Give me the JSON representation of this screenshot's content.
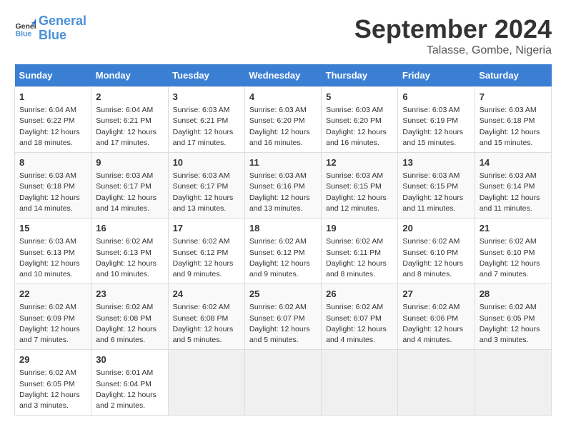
{
  "header": {
    "logo_line1": "General",
    "logo_line2": "Blue",
    "month": "September 2024",
    "location": "Talasse, Gombe, Nigeria"
  },
  "columns": [
    "Sunday",
    "Monday",
    "Tuesday",
    "Wednesday",
    "Thursday",
    "Friday",
    "Saturday"
  ],
  "weeks": [
    [
      {
        "day": "1",
        "info": "Sunrise: 6:04 AM\nSunset: 6:22 PM\nDaylight: 12 hours\nand 18 minutes."
      },
      {
        "day": "2",
        "info": "Sunrise: 6:04 AM\nSunset: 6:21 PM\nDaylight: 12 hours\nand 17 minutes."
      },
      {
        "day": "3",
        "info": "Sunrise: 6:03 AM\nSunset: 6:21 PM\nDaylight: 12 hours\nand 17 minutes."
      },
      {
        "day": "4",
        "info": "Sunrise: 6:03 AM\nSunset: 6:20 PM\nDaylight: 12 hours\nand 16 minutes."
      },
      {
        "day": "5",
        "info": "Sunrise: 6:03 AM\nSunset: 6:20 PM\nDaylight: 12 hours\nand 16 minutes."
      },
      {
        "day": "6",
        "info": "Sunrise: 6:03 AM\nSunset: 6:19 PM\nDaylight: 12 hours\nand 15 minutes."
      },
      {
        "day": "7",
        "info": "Sunrise: 6:03 AM\nSunset: 6:18 PM\nDaylight: 12 hours\nand 15 minutes."
      }
    ],
    [
      {
        "day": "8",
        "info": "Sunrise: 6:03 AM\nSunset: 6:18 PM\nDaylight: 12 hours\nand 14 minutes."
      },
      {
        "day": "9",
        "info": "Sunrise: 6:03 AM\nSunset: 6:17 PM\nDaylight: 12 hours\nand 14 minutes."
      },
      {
        "day": "10",
        "info": "Sunrise: 6:03 AM\nSunset: 6:17 PM\nDaylight: 12 hours\nand 13 minutes."
      },
      {
        "day": "11",
        "info": "Sunrise: 6:03 AM\nSunset: 6:16 PM\nDaylight: 12 hours\nand 13 minutes."
      },
      {
        "day": "12",
        "info": "Sunrise: 6:03 AM\nSunset: 6:15 PM\nDaylight: 12 hours\nand 12 minutes."
      },
      {
        "day": "13",
        "info": "Sunrise: 6:03 AM\nSunset: 6:15 PM\nDaylight: 12 hours\nand 11 minutes."
      },
      {
        "day": "14",
        "info": "Sunrise: 6:03 AM\nSunset: 6:14 PM\nDaylight: 12 hours\nand 11 minutes."
      }
    ],
    [
      {
        "day": "15",
        "info": "Sunrise: 6:03 AM\nSunset: 6:13 PM\nDaylight: 12 hours\nand 10 minutes."
      },
      {
        "day": "16",
        "info": "Sunrise: 6:02 AM\nSunset: 6:13 PM\nDaylight: 12 hours\nand 10 minutes."
      },
      {
        "day": "17",
        "info": "Sunrise: 6:02 AM\nSunset: 6:12 PM\nDaylight: 12 hours\nand 9 minutes."
      },
      {
        "day": "18",
        "info": "Sunrise: 6:02 AM\nSunset: 6:12 PM\nDaylight: 12 hours\nand 9 minutes."
      },
      {
        "day": "19",
        "info": "Sunrise: 6:02 AM\nSunset: 6:11 PM\nDaylight: 12 hours\nand 8 minutes."
      },
      {
        "day": "20",
        "info": "Sunrise: 6:02 AM\nSunset: 6:10 PM\nDaylight: 12 hours\nand 8 minutes."
      },
      {
        "day": "21",
        "info": "Sunrise: 6:02 AM\nSunset: 6:10 PM\nDaylight: 12 hours\nand 7 minutes."
      }
    ],
    [
      {
        "day": "22",
        "info": "Sunrise: 6:02 AM\nSunset: 6:09 PM\nDaylight: 12 hours\nand 7 minutes."
      },
      {
        "day": "23",
        "info": "Sunrise: 6:02 AM\nSunset: 6:08 PM\nDaylight: 12 hours\nand 6 minutes."
      },
      {
        "day": "24",
        "info": "Sunrise: 6:02 AM\nSunset: 6:08 PM\nDaylight: 12 hours\nand 5 minutes."
      },
      {
        "day": "25",
        "info": "Sunrise: 6:02 AM\nSunset: 6:07 PM\nDaylight: 12 hours\nand 5 minutes."
      },
      {
        "day": "26",
        "info": "Sunrise: 6:02 AM\nSunset: 6:07 PM\nDaylight: 12 hours\nand 4 minutes."
      },
      {
        "day": "27",
        "info": "Sunrise: 6:02 AM\nSunset: 6:06 PM\nDaylight: 12 hours\nand 4 minutes."
      },
      {
        "day": "28",
        "info": "Sunrise: 6:02 AM\nSunset: 6:05 PM\nDaylight: 12 hours\nand 3 minutes."
      }
    ],
    [
      {
        "day": "29",
        "info": "Sunrise: 6:02 AM\nSunset: 6:05 PM\nDaylight: 12 hours\nand 3 minutes."
      },
      {
        "day": "30",
        "info": "Sunrise: 6:01 AM\nSunset: 6:04 PM\nDaylight: 12 hours\nand 2 minutes."
      },
      {
        "day": "",
        "info": ""
      },
      {
        "day": "",
        "info": ""
      },
      {
        "day": "",
        "info": ""
      },
      {
        "day": "",
        "info": ""
      },
      {
        "day": "",
        "info": ""
      }
    ]
  ]
}
